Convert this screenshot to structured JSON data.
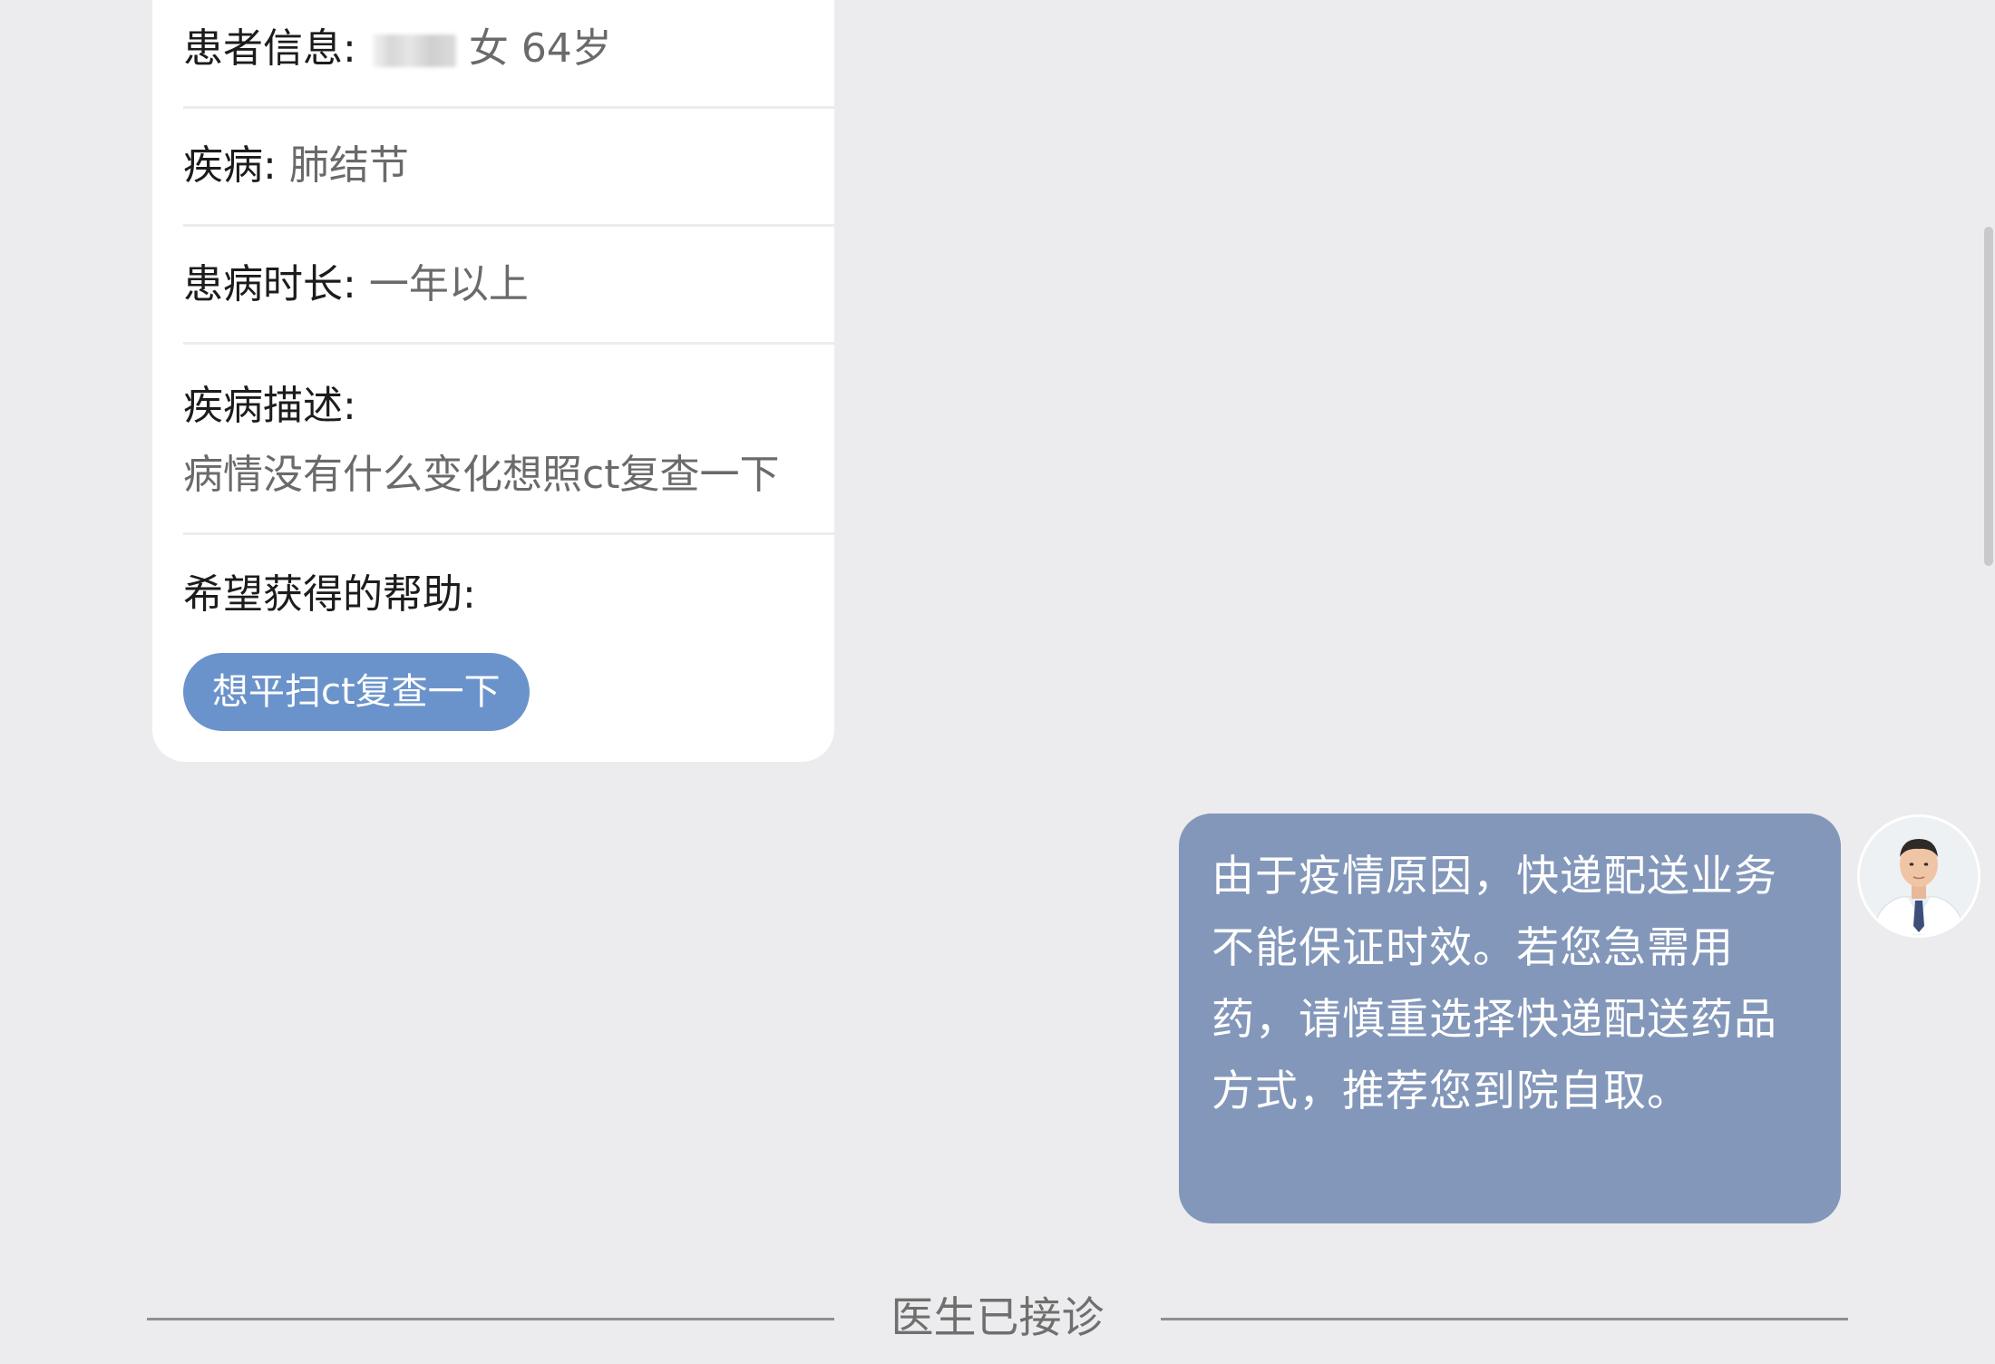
{
  "consultation_card": {
    "patient_info": {
      "label": "患者信息:",
      "gender_age": "女 64岁"
    },
    "disease": {
      "label": "疾病:",
      "value": "肺结节"
    },
    "duration": {
      "label": "患病时长:",
      "value": "一年以上"
    },
    "description": {
      "label": "疾病描述:",
      "value": "病情没有什么变化想照ct复查一下"
    },
    "help": {
      "label": "希望获得的帮助:",
      "tag": "想平扫ct复查一下"
    }
  },
  "doctor_message": {
    "text": "由于疫情原因，快递配送业务不能保证时效。若您急需用药，请慎重选择快递配送药品方式，推荐您到院自取。"
  },
  "status_divider": {
    "text": "医生已接诊"
  },
  "colors": {
    "background": "#ececee",
    "card": "#ffffff",
    "tag": "#6b93cb",
    "bubble": "#8397ba"
  },
  "icons": {
    "avatar": "doctor-avatar-photo"
  }
}
